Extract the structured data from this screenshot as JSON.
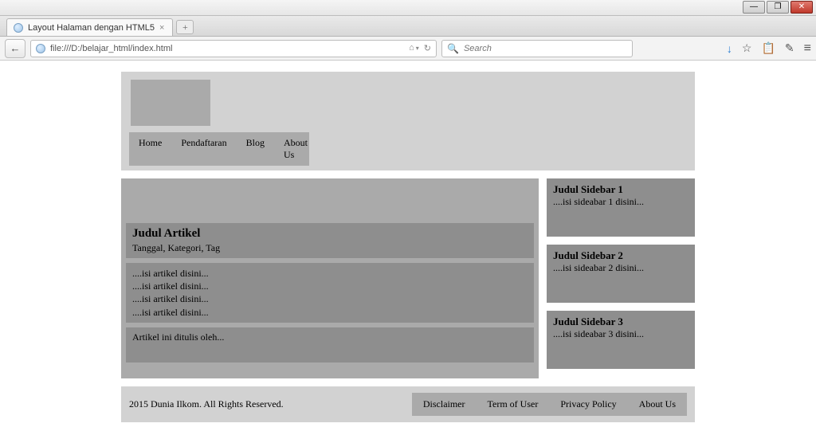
{
  "browser": {
    "tab_title": "Layout Halaman dengan HTML5",
    "url": "file:///D:/belajar_html/index.html",
    "search_placeholder": "Search",
    "reload_glyph": "↻",
    "home_glyph": "⌂",
    "back_glyph": "←",
    "newtab_glyph": "+",
    "tab_close_glyph": "×",
    "icons": {
      "download": "↓",
      "bookmark": "☆",
      "clipboard": "📋",
      "edit": "✎",
      "menu": "≡"
    },
    "win": {
      "min": "—",
      "max": "❐",
      "close": "✕"
    }
  },
  "nav": {
    "items": [
      "Home",
      "Pendaftaran",
      "Blog",
      "About Us"
    ]
  },
  "article": {
    "title": "Judul Artikel",
    "meta": "Tanggal, Kategori, Tag",
    "body": [
      "....isi artikel disini...",
      "....isi artikel disini...",
      "....isi artikel disini...",
      "....isi artikel disini..."
    ],
    "author_line": "Artikel ini ditulis oleh..."
  },
  "sidebar": {
    "widgets": [
      {
        "title": "Judul Sidebar 1",
        "body": "....isi sideabar 1 disini..."
      },
      {
        "title": "Judul Sidebar 2",
        "body": "....isi sideabar 2 disini..."
      },
      {
        "title": "Judul Sidebar 3",
        "body": "....isi sideabar 3 disini..."
      }
    ]
  },
  "footer": {
    "copyright": "2015 Dunia Ilkom. All Rights Reserved.",
    "links": [
      "Disclaimer",
      "Term of User",
      "Privacy Policy",
      "About Us"
    ]
  }
}
